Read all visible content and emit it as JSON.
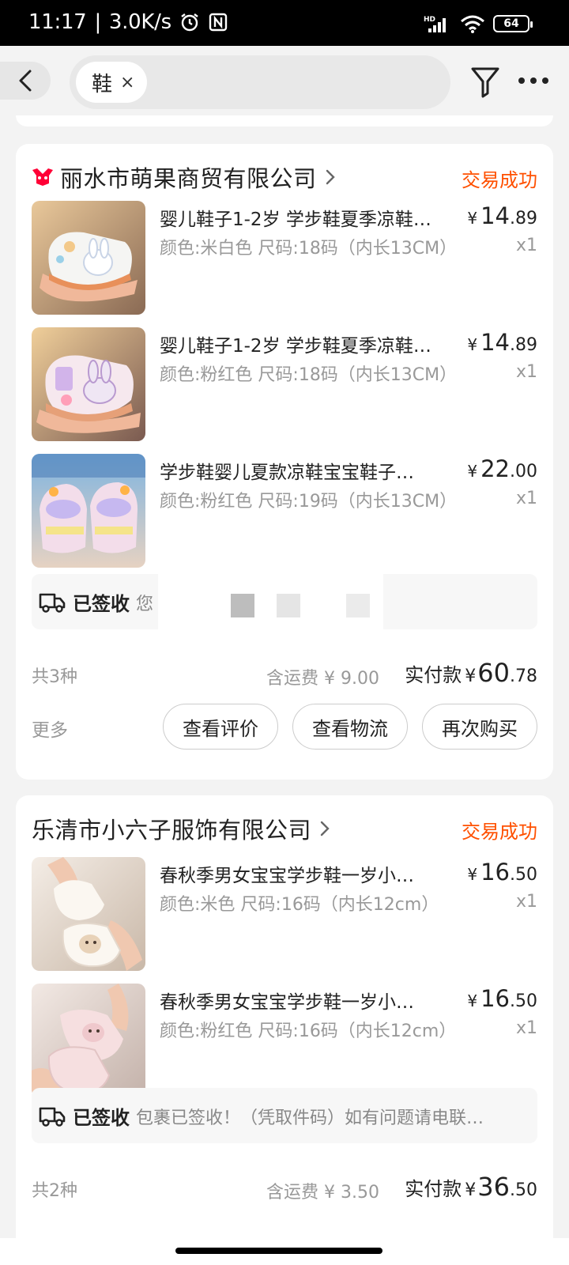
{
  "status_bar": {
    "time": "11:17",
    "speed": "3.0K/s",
    "battery": "64",
    "network": "HD"
  },
  "search": {
    "chip_label": "鞋",
    "chip_close": "×"
  },
  "orders": [
    {
      "shop_name": "丽水市萌果商贸有限公司",
      "status": "交易成功",
      "items": [
        {
          "title": "婴儿鞋子1-2岁 学步鞋夏季凉鞋…",
          "spec": "颜色:米白色  尺码:18码（内长13CM）",
          "price_currency": "¥",
          "price_int": "14",
          "price_dec": ".89",
          "qty": "x1"
        },
        {
          "title": "婴儿鞋子1-2岁 学步鞋夏季凉鞋…",
          "spec": "颜色:粉红色  尺码:18码（内长13CM）",
          "price_currency": "¥",
          "price_int": "14",
          "price_dec": ".89",
          "qty": "x1"
        },
        {
          "title": "学步鞋婴儿夏款凉鞋宝宝鞋子…",
          "spec": "颜色:粉红色  尺码:19码（内长13CM）",
          "price_currency": "¥",
          "price_int": "22",
          "price_dec": ".00",
          "qty": "x1"
        }
      ],
      "logistics": {
        "label": "已签收",
        "text": "您                                              取件，感谢使…"
      },
      "summary": {
        "count": "共3种",
        "shipping": "含运费 ¥ 9.00",
        "paid_label": "实付款",
        "paid_currency": "¥",
        "paid_int": "60",
        "paid_dec": ".78"
      },
      "actions": {
        "more": "更多",
        "buttons": [
          "查看评价",
          "查看物流",
          "再次购买"
        ]
      }
    },
    {
      "shop_name": "乐清市小六子服饰有限公司",
      "status": "交易成功",
      "items": [
        {
          "title": "春秋季男女宝宝学步鞋一岁小…",
          "spec": "颜色:米色  尺码:16码（内长12cm）",
          "price_currency": "¥",
          "price_int": "16",
          "price_dec": ".50",
          "qty": "x1"
        },
        {
          "title": "春秋季男女宝宝学步鞋一岁小…",
          "spec": "颜色:粉红色  尺码:16码（内长12cm）",
          "price_currency": "¥",
          "price_int": "16",
          "price_dec": ".50",
          "qty": "x1"
        }
      ],
      "logistics": {
        "label": "已签收",
        "text": "包裹已签收！（凭取件码）如有问题请电联…"
      },
      "summary": {
        "count": "共2种",
        "shipping": "含运费 ¥ 3.50",
        "paid_label": "实付款",
        "paid_currency": "¥",
        "paid_int": "36",
        "paid_dec": ".50"
      }
    }
  ],
  "colors": {
    "accent": "#ff5000",
    "background": "#f3f3f3",
    "card": "#ffffff",
    "muted_text": "#999999"
  }
}
